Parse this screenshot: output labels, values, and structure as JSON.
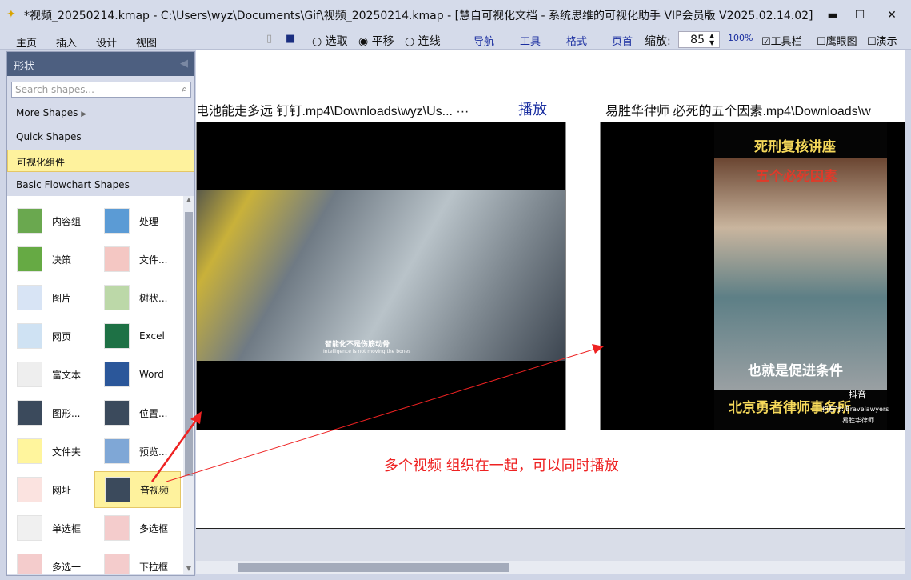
{
  "window": {
    "title": "*视频_20250214.kmap -  C:\\Users\\wyz\\Documents\\Gif\\视频_20250214.kmap - [慧自可视化文档 - 系统思维的可视化助手 VIP会员版 V2025.02.14.02]",
    "minimize": "▬",
    "maximize": "☐",
    "close": "✕"
  },
  "menu": [
    "主页",
    "插入",
    "设计",
    "视图"
  ],
  "toolbar": {
    "select": "选取",
    "pan": "平移",
    "connect": "连线",
    "nav": "导航",
    "tools": "工具",
    "format": "格式",
    "page_home": "页首",
    "zoom_label": "缩放:",
    "zoom_value": "85",
    "zoom_100": "100%",
    "toolbar_cb": "工具栏",
    "eagle_eye": "鹰眼图",
    "present": "演示",
    "mode_selected": "平移"
  },
  "panel": {
    "title": "形状",
    "search_placeholder": "Search shapes...",
    "categories": [
      "More Shapes",
      "Quick Shapes",
      "可视化组件",
      "Basic Flowchart Shapes"
    ],
    "selected_category": "可视化组件",
    "shapes": [
      "内容组",
      "处理",
      "决策",
      "文件...",
      "图片",
      "树状...",
      "网页",
      "Excel",
      "富文本",
      "Word",
      "图形...",
      "位置...",
      "文件夹",
      "预览...",
      "网址",
      "音视频",
      "单选框",
      "多选框",
      "多选一",
      "下拉框"
    ],
    "selected_shape": "音视频"
  },
  "canvas": {
    "video1": {
      "label": "电池能走多远 钉钉.mp4\\Downloads\\wyz\\Us... ···",
      "play": "播放",
      "subtitle": "智能化不是伤筋动骨",
      "subtitle_en": "Intelligence is not moving the bones"
    },
    "video2": {
      "label": "易胜华律师 必死的五个因素.mp4\\Downloads\\w",
      "title": "死刑复核讲座",
      "overlay": "五个必死因素",
      "subtitle": "也就是促进条件",
      "footer": "北京勇者律师事务所",
      "brand": "抖音",
      "account": "抖音号: Bravelawyers",
      "search_tag": "易胜华律师"
    },
    "annotation": "多个视频 组织在一起，可以同时播放",
    "annotation_color": "#ee2222"
  }
}
